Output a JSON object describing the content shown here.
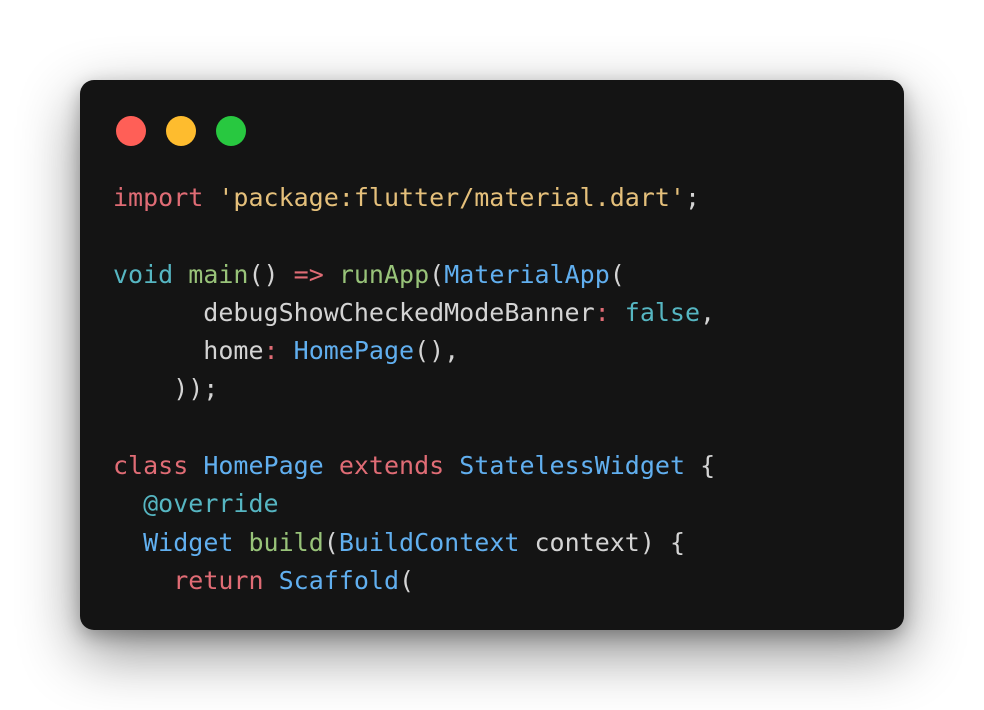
{
  "window": {
    "controls": [
      {
        "name": "close",
        "color": "#ff5f57"
      },
      {
        "name": "minimize",
        "color": "#febc2e"
      },
      {
        "name": "maximize",
        "color": "#28c840"
      }
    ]
  },
  "code_lines": [
    [
      {
        "t": "import",
        "c": "kw"
      },
      {
        "t": " ",
        "c": "plain"
      },
      {
        "t": "'package:flutter/material.dart'",
        "c": "str"
      },
      {
        "t": ";",
        "c": "plain"
      }
    ],
    [],
    [
      {
        "t": "void",
        "c": "type"
      },
      {
        "t": " ",
        "c": "plain"
      },
      {
        "t": "main",
        "c": "fn"
      },
      {
        "t": "() ",
        "c": "plain"
      },
      {
        "t": "=>",
        "c": "kw"
      },
      {
        "t": " ",
        "c": "plain"
      },
      {
        "t": "runApp",
        "c": "fn"
      },
      {
        "t": "(",
        "c": "plain"
      },
      {
        "t": "MaterialApp",
        "c": "cls"
      },
      {
        "t": "(",
        "c": "plain"
      }
    ],
    [
      {
        "t": "      debugShowCheckedModeBanner",
        "c": "plain"
      },
      {
        "t": ":",
        "c": "kw"
      },
      {
        "t": " ",
        "c": "plain"
      },
      {
        "t": "false",
        "c": "type"
      },
      {
        "t": ",",
        "c": "plain"
      }
    ],
    [
      {
        "t": "      home",
        "c": "plain"
      },
      {
        "t": ":",
        "c": "kw"
      },
      {
        "t": " ",
        "c": "plain"
      },
      {
        "t": "HomePage",
        "c": "cls"
      },
      {
        "t": "(),",
        "c": "plain"
      }
    ],
    [
      {
        "t": "    ));",
        "c": "plain"
      }
    ],
    [],
    [
      {
        "t": "class",
        "c": "kw"
      },
      {
        "t": " ",
        "c": "plain"
      },
      {
        "t": "HomePage",
        "c": "cls"
      },
      {
        "t": " ",
        "c": "plain"
      },
      {
        "t": "extends",
        "c": "kw"
      },
      {
        "t": " ",
        "c": "plain"
      },
      {
        "t": "StatelessWidget",
        "c": "cls"
      },
      {
        "t": " {",
        "c": "plain"
      }
    ],
    [
      {
        "t": "  ",
        "c": "plain"
      },
      {
        "t": "@override",
        "c": "ann"
      }
    ],
    [
      {
        "t": "  ",
        "c": "plain"
      },
      {
        "t": "Widget",
        "c": "cls"
      },
      {
        "t": " ",
        "c": "plain"
      },
      {
        "t": "build",
        "c": "fn"
      },
      {
        "t": "(",
        "c": "plain"
      },
      {
        "t": "BuildContext",
        "c": "cls"
      },
      {
        "t": " context) {",
        "c": "plain"
      }
    ],
    [
      {
        "t": "    ",
        "c": "plain"
      },
      {
        "t": "return",
        "c": "kw"
      },
      {
        "t": " ",
        "c": "plain"
      },
      {
        "t": "Scaffold",
        "c": "cls"
      },
      {
        "t": "(",
        "c": "plain"
      }
    ]
  ]
}
